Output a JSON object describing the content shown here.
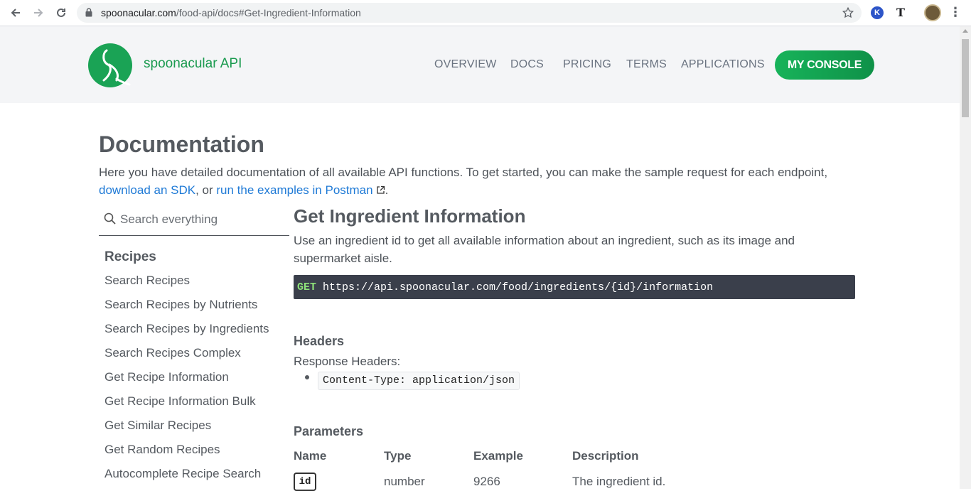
{
  "browser": {
    "url_host": "spoonacular.com",
    "url_path": "/food-api/docs#Get-Ingredient-Information",
    "ext_k_letter": "K",
    "ext_t_letter": "T"
  },
  "header": {
    "brand": "spoonacular API",
    "nav": [
      "OVERVIEW",
      "DOCS",
      "PRICING",
      "TERMS",
      "APPLICATIONS"
    ],
    "console_button": "MY CONSOLE"
  },
  "main": {
    "title": "Documentation",
    "intro_text_1": "Here you have detailed documentation of all available API functions. To get started, you can make the sample request for each endpoint, ",
    "intro_link_sdk": "download an SDK",
    "intro_text_2": ", or ",
    "intro_link_postman": "run the examples in Postman",
    "intro_text_3": "."
  },
  "sidebar": {
    "search_placeholder": "Search everything",
    "heading": "Recipes",
    "items": [
      "Search Recipes",
      "Search Recipes by Nutrients",
      "Search Recipes by Ingredients",
      "Search Recipes Complex",
      "Get Recipe Information",
      "Get Recipe Information Bulk",
      "Get Similar Recipes",
      "Get Random Recipes",
      "Autocomplete Recipe Search"
    ]
  },
  "endpoint": {
    "title": "Get Ingredient Information",
    "description": "Use an ingredient id to get all available information about an ingredient, such as its image and supermarket aisle.",
    "method": "GET",
    "url": "https://api.spoonacular.com/food/ingredients/{id}/information",
    "headers_heading": "Headers",
    "response_headers_label": "Response Headers:",
    "response_header_value": "Content-Type: application/json",
    "parameters_heading": "Parameters",
    "table_headers": [
      "Name",
      "Type",
      "Example",
      "Description"
    ],
    "rows": [
      {
        "name": "id",
        "type": "number",
        "example": "9266",
        "description": "The ingredient id."
      }
    ]
  },
  "colors": {
    "brand_green": "#1a9a4f",
    "link_blue": "#1f7ad6",
    "code_bg": "#3a3f4b",
    "method_green": "#8ee27a"
  }
}
